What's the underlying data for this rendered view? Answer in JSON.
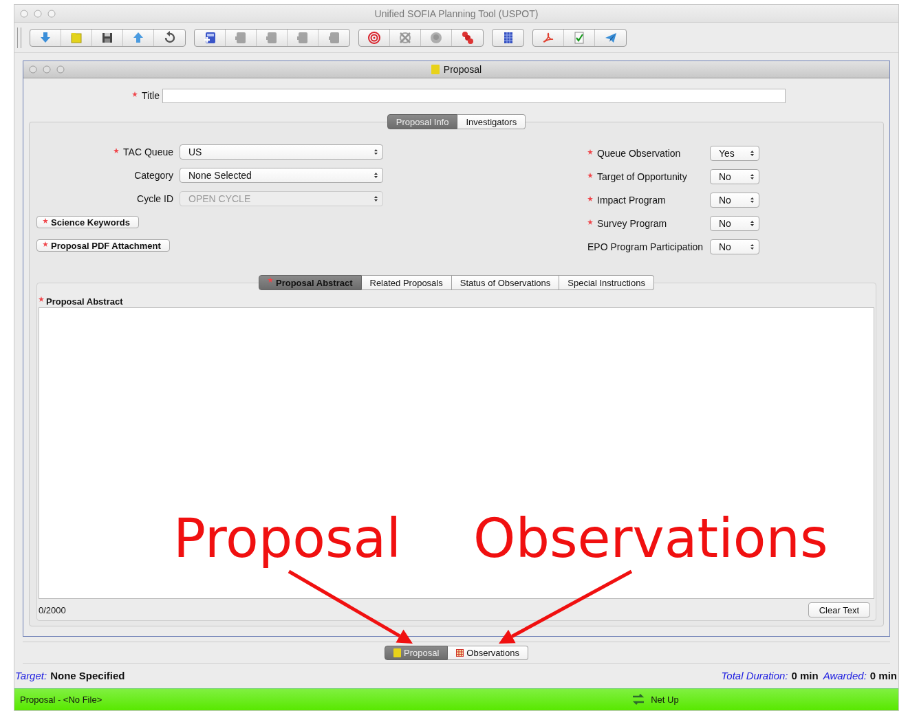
{
  "window": {
    "title": "Unified SOFIA Planning Tool (USPOT)"
  },
  "toolbar": [
    {
      "items": [
        {
          "kind": "download",
          "disabled": false
        },
        {
          "kind": "open",
          "disabled": false
        },
        {
          "kind": "save",
          "disabled": false
        },
        {
          "kind": "upload",
          "disabled": false
        },
        {
          "kind": "revert",
          "disabled": false
        }
      ]
    },
    {
      "items": [
        {
          "kind": "aor-add",
          "disabled": false
        },
        {
          "kind": "doc",
          "disabled": true
        },
        {
          "kind": "doc",
          "disabled": true
        },
        {
          "kind": "doc",
          "disabled": true
        },
        {
          "kind": "doc",
          "disabled": true
        }
      ]
    },
    {
      "items": [
        {
          "kind": "target",
          "disabled": false
        },
        {
          "kind": "target-x",
          "disabled": true
        },
        {
          "kind": "circle",
          "disabled": true
        },
        {
          "kind": "circles",
          "disabled": false
        }
      ]
    },
    {
      "items": [
        {
          "kind": "grid",
          "disabled": false
        }
      ]
    },
    {
      "items": [
        {
          "kind": "pdf",
          "disabled": false
        },
        {
          "kind": "check",
          "disabled": false
        },
        {
          "kind": "send",
          "disabled": false
        }
      ]
    }
  ],
  "proposal_window": {
    "title": "Proposal",
    "title_field": {
      "label": "Title",
      "required": true
    },
    "tabs": [
      {
        "label": "Proposal Info",
        "selected": true
      },
      {
        "label": "Investigators",
        "selected": false
      }
    ],
    "left_fields": [
      {
        "label": "TAC Queue",
        "required": true,
        "value": "US",
        "disabled": false
      },
      {
        "label": "Category",
        "required": false,
        "value": "None Selected",
        "disabled": false
      },
      {
        "label": "Cycle ID",
        "required": false,
        "value": "OPEN CYCLE",
        "disabled": true
      }
    ],
    "buttons": [
      {
        "label": "Science Keywords",
        "required": true
      },
      {
        "label": "Proposal PDF Attachment",
        "required": true
      }
    ],
    "right_fields": [
      {
        "label": "Queue Observation",
        "required": true,
        "value": "Yes"
      },
      {
        "label": "Target of Opportunity",
        "required": true,
        "value": "No"
      },
      {
        "label": "Impact Program",
        "required": true,
        "value": "No"
      },
      {
        "label": "Survey Program",
        "required": true,
        "value": "No"
      },
      {
        "label": "EPO Program Participation",
        "required": false,
        "value": "No"
      }
    ],
    "sub_tabs": [
      {
        "label": "Proposal Abstract",
        "required": true,
        "selected": true
      },
      {
        "label": "Related Proposals",
        "required": false,
        "selected": false
      },
      {
        "label": "Status of Observations",
        "required": false,
        "selected": false
      },
      {
        "label": "Special Instructions",
        "required": false,
        "selected": false
      }
    ],
    "abstract": {
      "label": "Proposal Abstract",
      "required": true,
      "counter": "0/2000",
      "clear_button": "Clear Text"
    }
  },
  "bottom_tabs": [
    {
      "label": "Proposal",
      "kind": "document",
      "selected": true
    },
    {
      "label": "Observations",
      "kind": "grid",
      "selected": false
    }
  ],
  "status_line": {
    "target_label": "Target:",
    "target_value": "None Specified",
    "duration_label": "Total Duration:",
    "duration_value": "0 min",
    "awarded_label": "Awarded:",
    "awarded_value": "0 min"
  },
  "status_bar": {
    "file": "Proposal - <No File>",
    "network": "Net Up"
  },
  "annotations": [
    {
      "text": "Proposal"
    },
    {
      "text": "Observations"
    }
  ]
}
